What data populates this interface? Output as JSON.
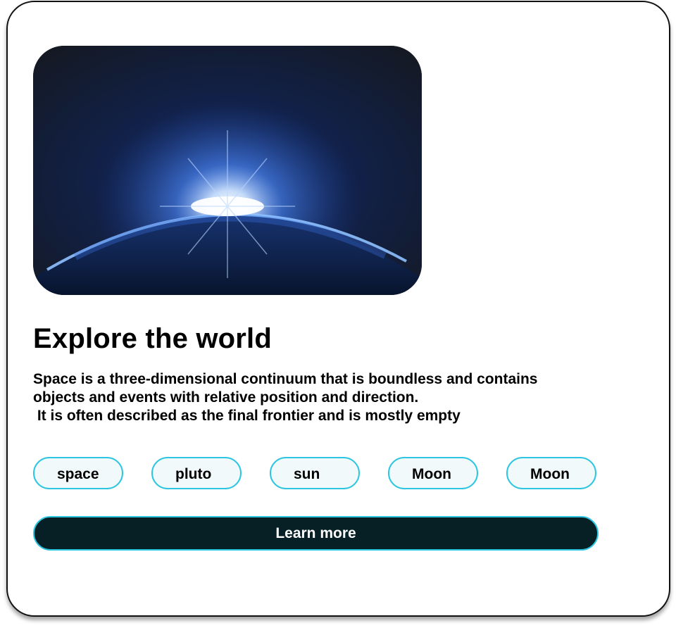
{
  "card": {
    "image_alt": "Planet horizon with sunrise in space",
    "title": "Explore the world",
    "description": [
      "Space is a three-dimensional continuum that is boundless and contains",
      "objects and events with relative position and direction.",
      " It is often described as the final frontier and is mostly empty"
    ],
    "tags": [
      "space",
      "pluto",
      "sun",
      "Moon",
      "Moon"
    ],
    "cta_label": "Learn more"
  },
  "colors": {
    "tag_border": "#2cc6e0",
    "tag_background": "#f1f9fb",
    "cta_background": "#062026",
    "cta_text": "#ffffff"
  }
}
